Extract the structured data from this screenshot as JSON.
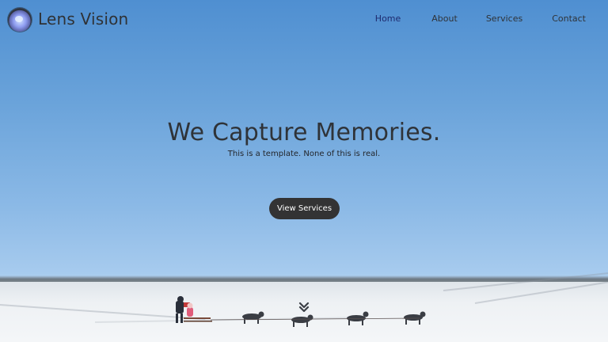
{
  "header": {
    "brand": "Lens Vision",
    "nav": [
      {
        "label": "Home",
        "active": true
      },
      {
        "label": "About",
        "active": false
      },
      {
        "label": "Services",
        "active": false
      },
      {
        "label": "Contact",
        "active": false
      }
    ]
  },
  "hero": {
    "headline": "We Capture Memories.",
    "subline": "This is a template. None of this is real.",
    "cta_label": "View Services"
  },
  "icons": {
    "logo": "camera-lens-icon",
    "scroll": "double-chevron-down-icon"
  },
  "colors": {
    "sky_top": "#4f8fd1",
    "sky_bottom": "#b5d2f0",
    "snow": "#f1f4f6",
    "nav_text": "#2f3338",
    "nav_active": "#1e2a6e",
    "cta_bg": "#333334",
    "cta_text": "#ffffff"
  }
}
